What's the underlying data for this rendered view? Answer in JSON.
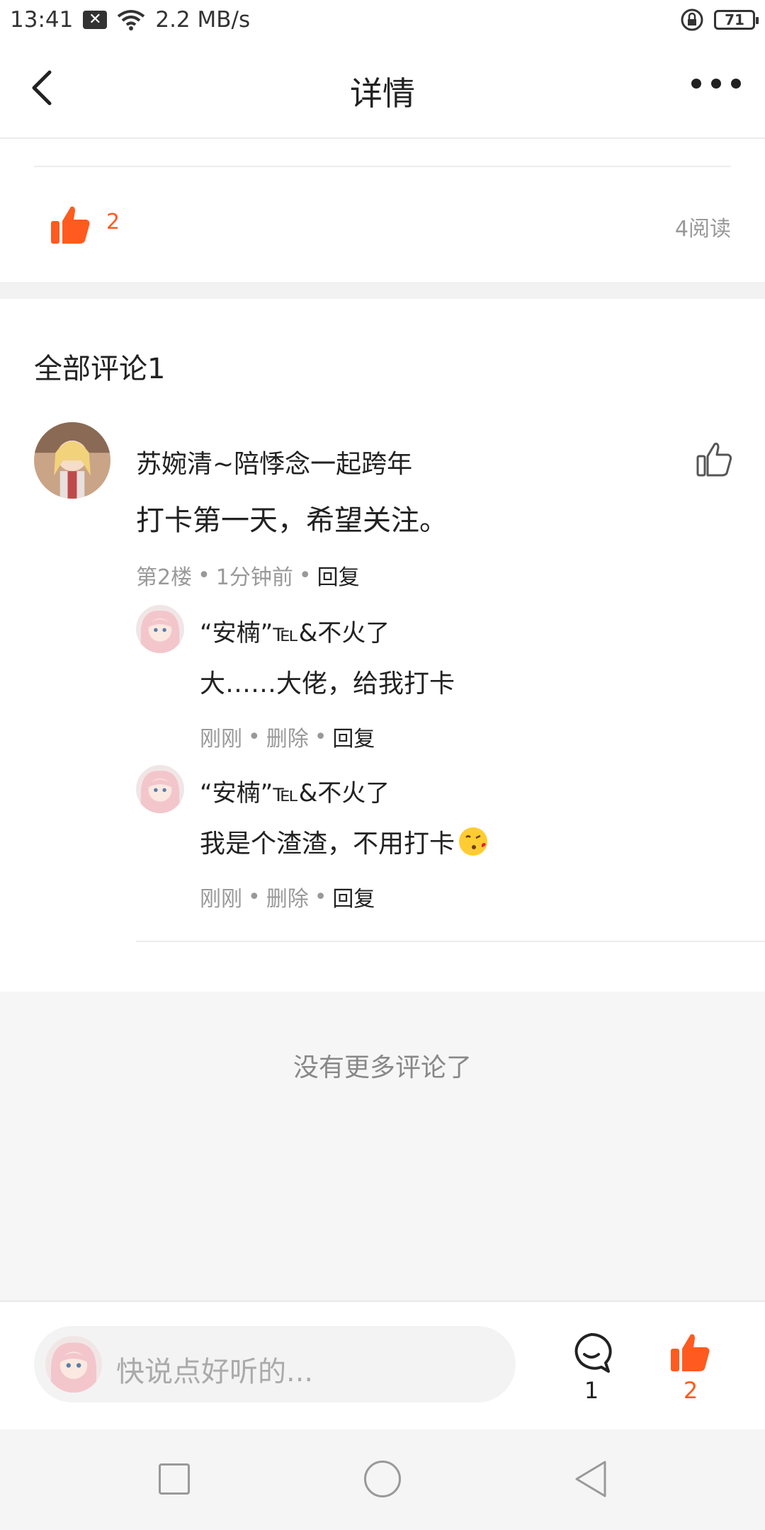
{
  "status_bar": {
    "time": "13:41",
    "speed": "2.2 MB/s",
    "battery": "71"
  },
  "header": {
    "title": "详情"
  },
  "post": {
    "like_count": "2",
    "read_count": "4阅读"
  },
  "comments": {
    "title": "全部评论1",
    "items": [
      {
        "user": "苏婉清~陪悸念一起跨年",
        "text": "打卡第一天，希望关注。",
        "floor": "第2楼",
        "time": "1分钟前",
        "reply": "回复",
        "replies": [
          {
            "user": "“安楠”℡&不火了",
            "text": "大……大佬，给我打卡",
            "time": "刚刚",
            "delete": "删除",
            "reply": "回复"
          },
          {
            "user": "“安楠”℡&不火了",
            "text": "我是个渣渣，不用打卡",
            "emoji": "kissing-face-emoji",
            "time": "刚刚",
            "delete": "删除",
            "reply": "回复"
          }
        ]
      }
    ],
    "no_more": "没有更多评论了"
  },
  "bottom_bar": {
    "placeholder": "快说点好听的...",
    "comment_count": "1",
    "like_count": "2"
  },
  "colors": {
    "accent": "#ff5a1f",
    "muted": "#999999",
    "band": "#f2f2f2"
  },
  "icons": [
    "close-icon",
    "wifi-icon",
    "lock-icon",
    "battery-icon",
    "back-arrow-icon",
    "more-icon",
    "thumbs-up-icon",
    "comment-icon",
    "square-icon",
    "circle-icon",
    "triangle-icon"
  ]
}
